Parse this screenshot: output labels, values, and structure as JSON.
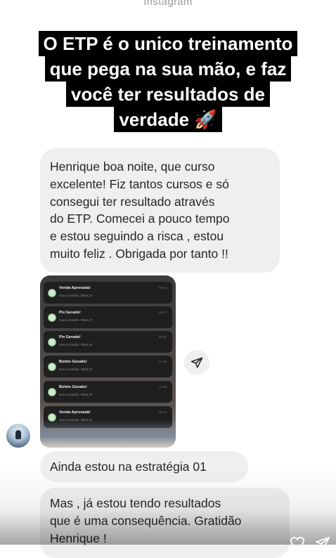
{
  "app": {
    "title": "Instagram"
  },
  "headline": {
    "lines": [
      "O ETP é o unico treinamento",
      "que pega na sua mão, e faz",
      "você ter resultados de",
      "verdade 🚀"
    ]
  },
  "messages": {
    "first": {
      "lines": [
        "Henrique boa noite, que curso",
        "excelente! Fiz tantos cursos e só",
        "consegui ter resultado através",
        "do ETP. Comecei a pouco tempo",
        "e estou seguindo a risca , estou",
        "muito feliz . Obrigada por tanto !!"
      ]
    },
    "second": {
      "text": "Ainda estou na estratégia 01"
    },
    "third": {
      "lines": [
        "Mas , já estou tendo resultados",
        "que é uma consequência. Gratidão",
        "Henrique !"
      ]
    }
  },
  "screenshot_notifications": [
    {
      "title": "Venda Aprovada!",
      "subtitle": "Sua comissão: R$44,37",
      "time": "08:00"
    },
    {
      "title": "Pix Gerado!",
      "subtitle": "Sua comissão: R$44,37",
      "time": "08:00"
    },
    {
      "title": "Pix Gerado!",
      "subtitle": "Sua comissão: R$44,37",
      "time": "08:01"
    },
    {
      "title": "Boleto Gerado!",
      "subtitle": "Sua comissão: R$44,37",
      "time": "12:06"
    },
    {
      "title": "Boleto Gerado!",
      "subtitle": "Sua comissão: R$44,37",
      "time": "13:05"
    },
    {
      "title": "Venda Aprovada!",
      "subtitle": "Sua comissão: R$44,37",
      "time": "18:14"
    }
  ],
  "icons": {
    "share": "send-icon",
    "avatar": "avatar",
    "notification": "check-circle-icon",
    "like": "heart-icon",
    "send": "paper-plane-icon"
  }
}
